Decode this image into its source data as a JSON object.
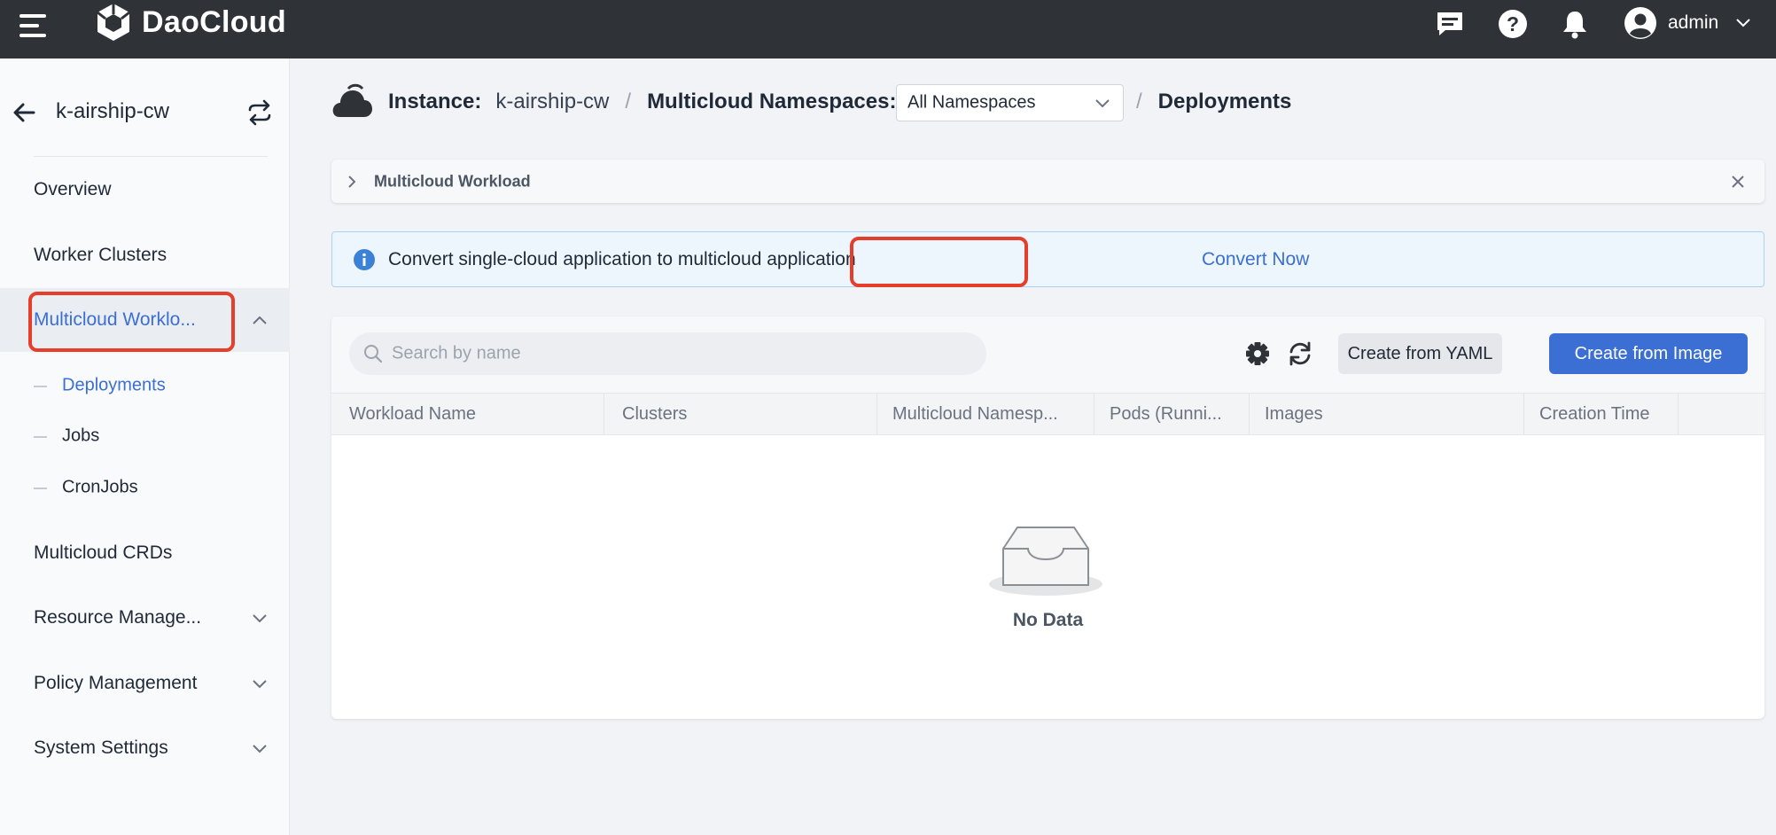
{
  "topbar": {
    "brand": "DaoCloud",
    "user": "admin",
    "icons": [
      "menu-icon",
      "message-icon",
      "help-icon",
      "bell-icon",
      "user-avatar-icon",
      "chevron-down-icon"
    ]
  },
  "sidebar": {
    "instance": "k-airship-cw",
    "items": [
      {
        "label": "Overview"
      },
      {
        "label": "Worker Clusters"
      },
      {
        "label": "Multicloud Worklo..."
      },
      {
        "label": "Multicloud CRDs"
      },
      {
        "label": "Resource Manage..."
      },
      {
        "label": "Policy Management"
      },
      {
        "label": "System Settings"
      }
    ],
    "subitems": [
      {
        "label": "Deployments"
      },
      {
        "label": "Jobs"
      },
      {
        "label": "CronJobs"
      }
    ]
  },
  "breadcrumb": {
    "instance_label": "Instance:",
    "instance_value": "k-airship-cw",
    "sep": "/",
    "ns_label": "Multicloud Namespaces:",
    "ns_value": "All Namespaces",
    "page": "Deployments"
  },
  "panel": {
    "title": "Multicloud Workload"
  },
  "alert": {
    "text": "Convert single-cloud application to multicloud application",
    "link": "Convert Now"
  },
  "table": {
    "search_placeholder": "Search by name",
    "btn_yaml": "Create from YAML",
    "btn_image": "Create from Image",
    "columns": [
      "Workload Name",
      "Clusters",
      "Multicloud Namesp...",
      "Pods (Runni...",
      "Images",
      "Creation Time"
    ],
    "empty": "No Data"
  },
  "colors": {
    "accent": "#3b6fd4",
    "topbar": "#2f3237",
    "highlight": "#e53e2b"
  }
}
